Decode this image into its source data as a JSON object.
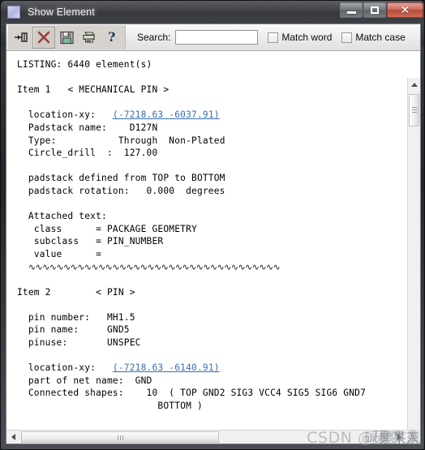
{
  "window": {
    "title": "Show Element",
    "icon": "app-icon",
    "buttons": {
      "minimize": "Minimize",
      "maximize": "Maximize",
      "close": "✕"
    }
  },
  "toolbar": {
    "buttons": [
      {
        "name": "pin-button",
        "tooltip": "Pin"
      },
      {
        "name": "close-button",
        "tooltip": "Close"
      },
      {
        "name": "save-button",
        "tooltip": "Save"
      },
      {
        "name": "print-button",
        "tooltip": "Print"
      },
      {
        "name": "help-button",
        "tooltip": "Help"
      }
    ],
    "search_label": "Search:",
    "search_value": "",
    "search_placeholder": "",
    "match_word_label": "Match word",
    "match_case_label": "Match case",
    "match_word_checked": false,
    "match_case_checked": false
  },
  "listing": {
    "header": "LISTING: 6440 element(s)",
    "items": [
      {
        "index_label": "Item 1",
        "type_label": "< MECHANICAL PIN >",
        "fields": [
          {
            "key": "location-xy:",
            "value": "(-7218.63 -6037.91)",
            "link": true
          },
          {
            "key": "Padstack name:",
            "value": "D127N"
          },
          {
            "key": "Type:",
            "value": "Through  Non-Plated"
          },
          {
            "key": "Circle_drill  :",
            "value": "127.00"
          }
        ],
        "notes": [
          "padstack defined from TOP to BOTTOM",
          "padstack rotation:   0.000  degrees"
        ],
        "attached_text_label": "Attached text:",
        "attached_text": [
          {
            "key": "class",
            "value": "PACKAGE GEOMETRY"
          },
          {
            "key": "subclass",
            "value": "PIN_NUMBER"
          },
          {
            "key": "value",
            "value": ""
          }
        ],
        "separator": "∿∿∿∿∿∿∿∿∿∿∿∿∿∿∿∿∿∿∿∿∿∿∿∿∿∿∿∿∿∿∿∿∿∿∿∿"
      },
      {
        "index_label": "Item 2",
        "type_label": "< PIN >",
        "fields": [
          {
            "key": "pin number:",
            "value": "MH1.5"
          },
          {
            "key": "pin name:",
            "value": "GND5"
          },
          {
            "key": "pinuse:",
            "value": "UNSPEC"
          }
        ],
        "fields2": [
          {
            "key": "location-xy:",
            "value": "(-7218.63 -6140.91)",
            "link": true
          },
          {
            "key": "part of net name:",
            "value": "GND"
          },
          {
            "key": "Connected shapes:",
            "value": "10  ( TOP GND2 SIG3 VCC4 SIG5 SIG6 GND7"
          },
          {
            "key": "",
            "value": "BOTTOM )"
          }
        ]
      }
    ]
  },
  "scrollbars": {
    "vertical_position": "top",
    "horizontal_position": "left"
  },
  "watermark": {
    "text": "CSDN @硬件人",
    "overlay1": "碌業某業",
    "overlay2": "椰果茶"
  }
}
